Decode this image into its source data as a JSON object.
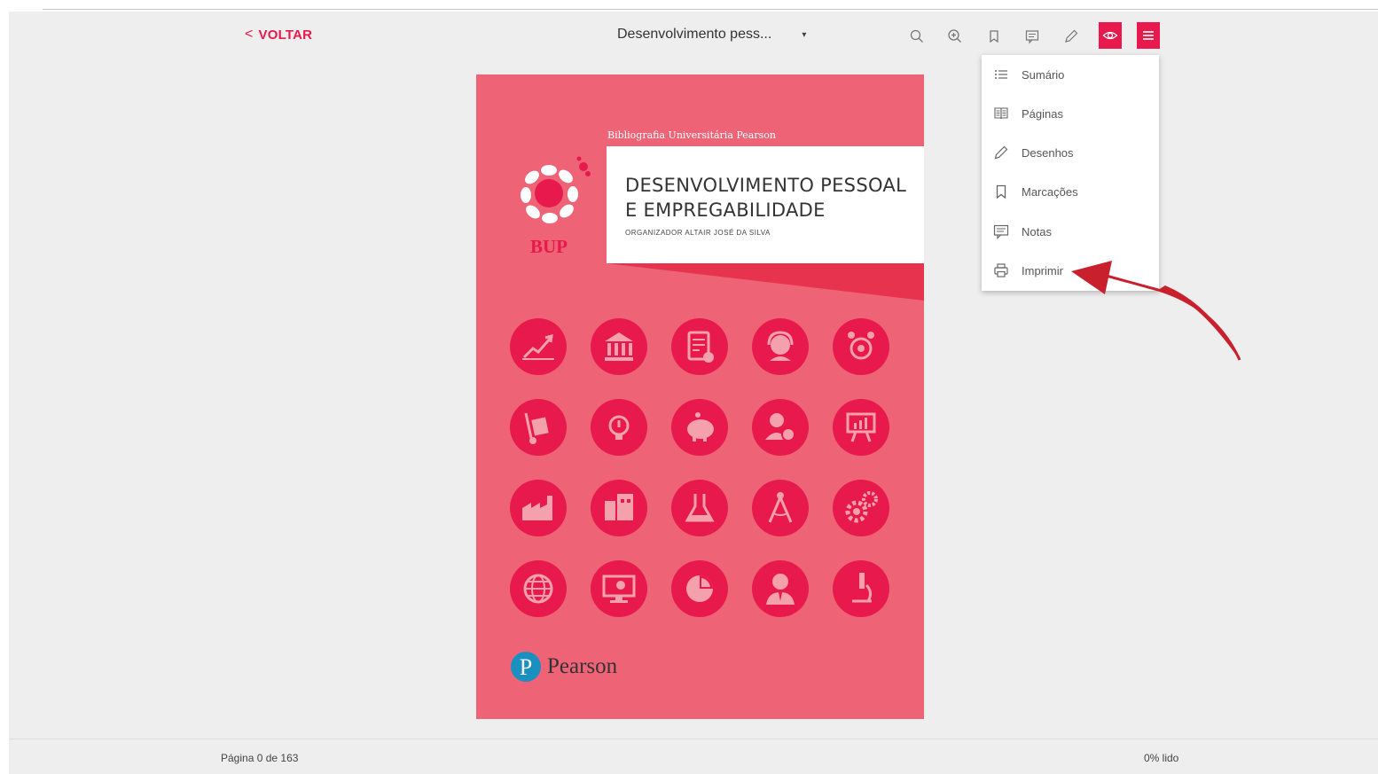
{
  "header": {
    "back_label": "VOLTAR",
    "back_chevron": "<",
    "book_title": "Desenvolvimento pess...",
    "book_title_caret": "▾"
  },
  "toolbar": {
    "icons": [
      "search-icon",
      "zoom-in-icon",
      "bookmark-icon",
      "notes-icon",
      "pencil-icon",
      "eye-icon",
      "menu-icon"
    ],
    "accent_color": "#e8194c"
  },
  "menu": {
    "items": [
      {
        "label": "Sumário",
        "icon": "list-icon"
      },
      {
        "label": "Páginas",
        "icon": "book-pages-icon"
      },
      {
        "label": "Desenhos",
        "icon": "pencil-icon"
      },
      {
        "label": "Marcações",
        "icon": "bookmark-icon"
      },
      {
        "label": "Notas",
        "icon": "notes-icon"
      },
      {
        "label": "Imprimir",
        "icon": "printer-icon"
      }
    ]
  },
  "cover": {
    "series": "Bibliografia Universitária Pearson",
    "title_line1": "DESENVOLVIMENTO PESSOAL",
    "title_line2": "E EMPREGABILIDADE",
    "organizer": "Organizador Altair José da Silva",
    "imprint": "BUP",
    "publisher": "Pearson",
    "publisher_logo_letter": "P",
    "background_color": "#ef6376",
    "circle_color": "#e8194c"
  },
  "footer": {
    "page_info": "Página 0 de 163",
    "read_info": "0% lido"
  },
  "annotation": {
    "arrow_color": "#c8202c"
  }
}
